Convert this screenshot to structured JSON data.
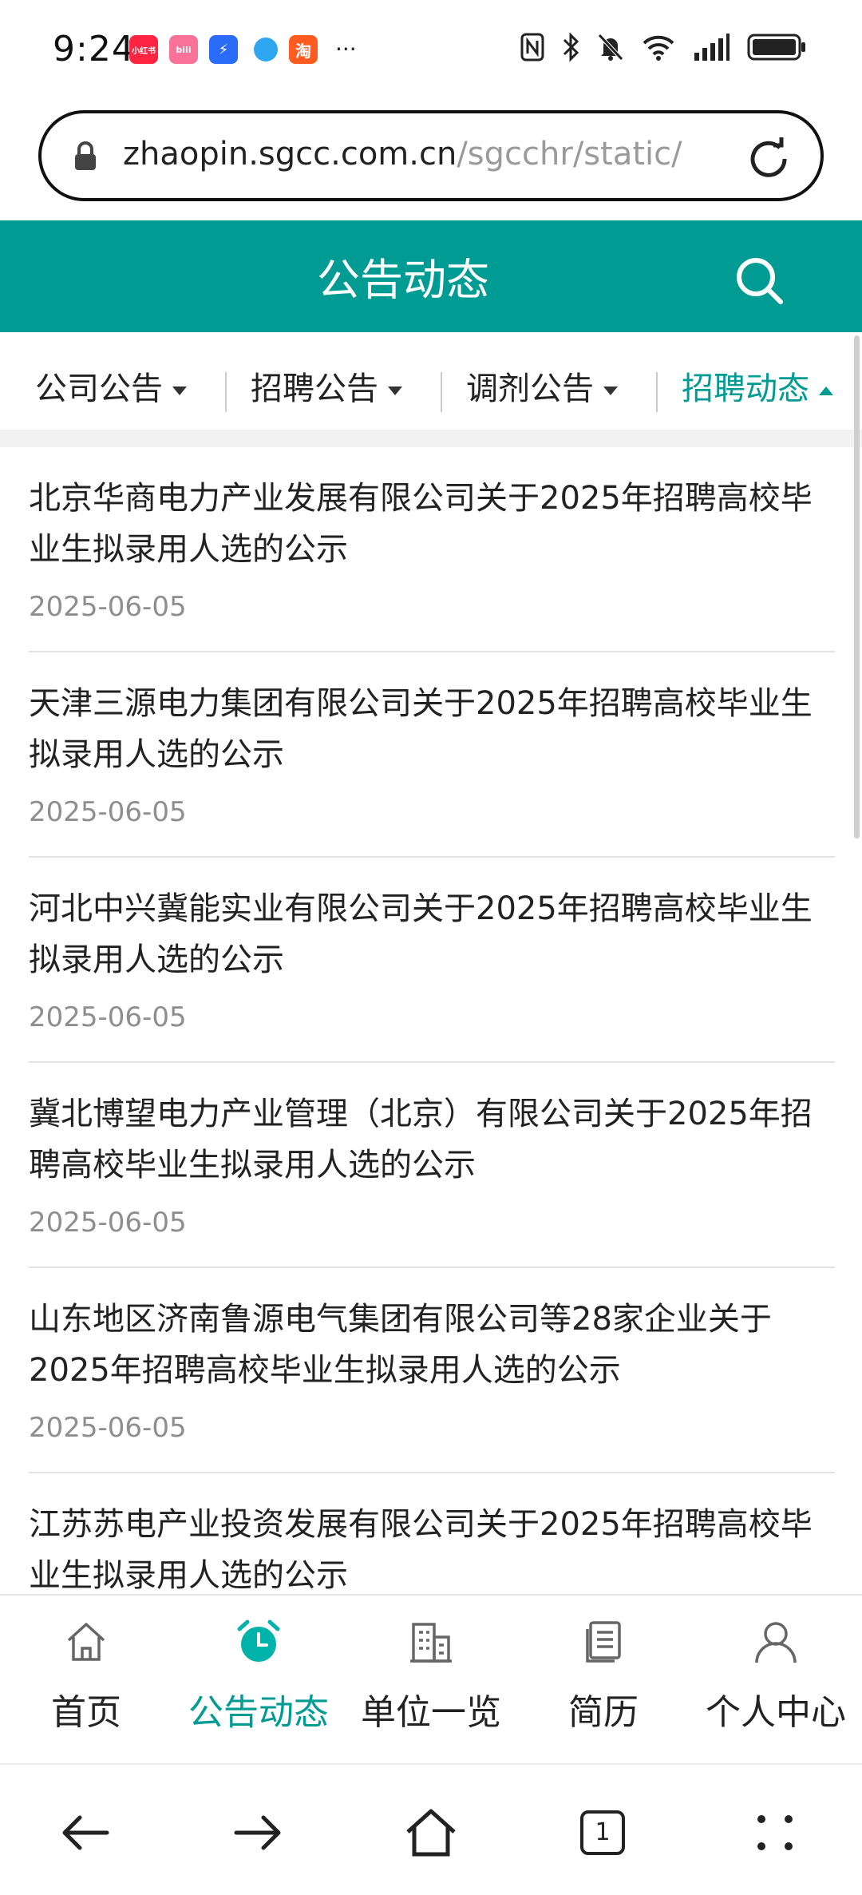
{
  "status_bar": {
    "time": "9:24",
    "app_icons": [
      {
        "name": "xiaohongshu-icon",
        "label": "小红书",
        "color": "#ff2442"
      },
      {
        "name": "bilibili-icon",
        "label": "bili",
        "color": "#fb7299"
      },
      {
        "name": "lightning-app-icon",
        "label": "⚡",
        "color": "#2a6cf6"
      },
      {
        "name": "blue-bird-icon",
        "label": "",
        "color": "#2fa7f0"
      },
      {
        "name": "taobao-icon",
        "label": "淘",
        "color": "#ff5a1f"
      }
    ],
    "more": "···"
  },
  "browser": {
    "url_host": "zhaopin.sgcc.com.cn",
    "url_path": "/sgcchr/static/",
    "tab_count": "1"
  },
  "header": {
    "title": "公告动态"
  },
  "tabs": [
    {
      "label": "公司公告",
      "active": false
    },
    {
      "label": "招聘公告",
      "active": false
    },
    {
      "label": "调剂公告",
      "active": false
    },
    {
      "label": "招聘动态",
      "active": true
    }
  ],
  "list": [
    {
      "title": "北京华商电力产业发展有限公司关于2025年招聘高校毕业生拟录用人选的公示",
      "date": "2025-06-05"
    },
    {
      "title": "天津三源电力集团有限公司关于2025年招聘高校毕业生拟录用人选的公示",
      "date": "2025-06-05"
    },
    {
      "title": "河北中兴冀能实业有限公司关于2025年招聘高校毕业生拟录用人选的公示",
      "date": "2025-06-05"
    },
    {
      "title": "冀北博望电力产业管理（北京）有限公司关于2025年招聘高校毕业生拟录用人选的公示",
      "date": "2025-06-05"
    },
    {
      "title": "山东地区济南鲁源电气集团有限公司等28家企业关于2025年招聘高校毕业生拟录用人选的公示",
      "date": "2025-06-05"
    },
    {
      "title": "江苏苏电产业投资发展有限公司关于2025年招聘高校毕业生拟录用人选的公示",
      "date": ""
    }
  ],
  "bottom_nav": [
    {
      "label": "首页",
      "icon": "home-icon",
      "active": false
    },
    {
      "label": "公告动态",
      "icon": "alarm-clock-icon",
      "active": true
    },
    {
      "label": "单位一览",
      "icon": "building-icon",
      "active": false
    },
    {
      "label": "简历",
      "icon": "document-icon",
      "active": false
    },
    {
      "label": "个人中心",
      "icon": "user-icon",
      "active": false
    }
  ],
  "colors": {
    "accent": "#009b93",
    "text": "#222222",
    "date": "#8e8e8e"
  }
}
